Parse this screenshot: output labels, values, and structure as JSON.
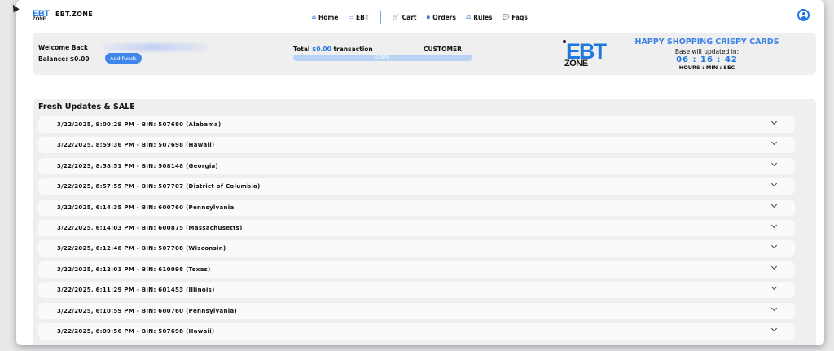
{
  "nav": {
    "logo_top": "EBT",
    "logo_bottom": "ZONE",
    "brand": "EBT.ZONE",
    "links": [
      {
        "label": "Home",
        "icon": "home-icon",
        "glyph": "⌂"
      },
      {
        "label": "EBT",
        "icon": "card-icon",
        "glyph": "▭"
      }
    ],
    "links_right": [
      {
        "label": "Cart",
        "icon": "cart-icon",
        "glyph": "🛒"
      },
      {
        "label": "Orders",
        "icon": "orders-icon",
        "glyph": "▪"
      },
      {
        "label": "Rules",
        "icon": "rules-icon",
        "glyph": "⚖"
      },
      {
        "label": "Faqs",
        "icon": "faqs-icon",
        "glyph": "💬"
      }
    ]
  },
  "info": {
    "welcome": "Welcome Back",
    "balance_label": "Balance: $0.00",
    "add_funds": "Add funds",
    "total_prefix": "Total ",
    "total_amount": "$0.00",
    "total_suffix": " transaction",
    "customer": "CUSTOMER",
    "progress_text": "0.00%",
    "progress_value": 0
  },
  "promo": {
    "logo_top": "EBT",
    "logo_bottom": "ZONE",
    "title": "HAPPY SHOPPING CRISPY CARDS",
    "subtitle": "Base will updated in:",
    "countdown": "06 : 16 : 42",
    "countdown_label": "HOURS : MIN : SEC"
  },
  "updates": {
    "title": "Fresh Updates & SALE",
    "items": [
      "3/22/2025, 9:00:29 PM - BIN: 507680 (Alabama)",
      "3/22/2025, 8:59:36 PM - BIN: 507698 (Hawaii)",
      "3/22/2025, 8:58:51 PM - BIN: 508148 (Georgia)",
      "3/22/2025, 8:57:55 PM - BIN: 507707 (District of Columbia)",
      "3/22/2025, 6:14:35 PM - BIN: 600760 (Pennsylvania",
      "3/22/2025, 6:14:03 PM - BIN: 600875 (Massachusetts)",
      "3/22/2025, 6:12:46 PM - BIN: 507708 (Wisconsin)",
      "3/22/2025, 6:12:01 PM - BIN: 610098 (Texas)",
      "3/22/2025, 6:11:29 PM - BIN: 601453 (Illinois)",
      "3/22/2025, 6:10:59 PM - BIN: 600760 (Pennsylvania)",
      "3/22/2025, 6:09:56 PM - BIN: 507698 (Hawaii)"
    ]
  },
  "colors": {
    "accent": "#1f78e0",
    "panel_bg": "#efefef",
    "row_bg": "#fafafa"
  }
}
